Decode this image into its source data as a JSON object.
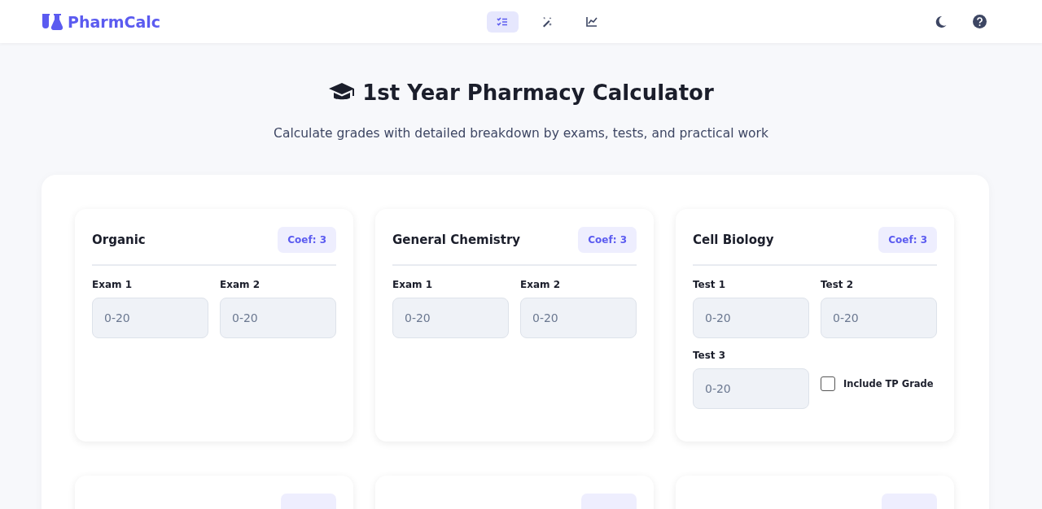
{
  "brand": {
    "name": "PharmCalc"
  },
  "nav_tabs": [
    {
      "kind": "checklist",
      "selected": true
    },
    {
      "kind": "wand",
      "selected": false
    },
    {
      "kind": "chart",
      "selected": false
    }
  ],
  "header": {
    "title": "1st Year Pharmacy Calculator",
    "subtitle": "Calculate grades with detailed breakdown by exams, tests, and practical work"
  },
  "modules": [
    {
      "name": "Organic",
      "badge": "Coef: 3",
      "fields": [
        {
          "kind": "input",
          "label": "Exam 1",
          "placeholder": "0-20"
        },
        {
          "kind": "input",
          "label": "Exam 2",
          "placeholder": "0-20"
        }
      ]
    },
    {
      "name": "General Chemistry",
      "badge": "Coef: 3",
      "fields": [
        {
          "kind": "input",
          "label": "Exam 1",
          "placeholder": "0-20"
        },
        {
          "kind": "input",
          "label": "Exam 2",
          "placeholder": "0-20"
        }
      ]
    },
    {
      "name": "Cell Biology",
      "badge": "Coef: 3",
      "fields": [
        {
          "kind": "input",
          "label": "Test 1",
          "placeholder": "0-20"
        },
        {
          "kind": "input",
          "label": "Test 2",
          "placeholder": "0-20"
        },
        {
          "kind": "input",
          "label": "Test 3",
          "placeholder": "0-20"
        },
        {
          "kind": "checkbox",
          "label": "Include TP Grade",
          "checked": false
        }
      ]
    }
  ]
}
